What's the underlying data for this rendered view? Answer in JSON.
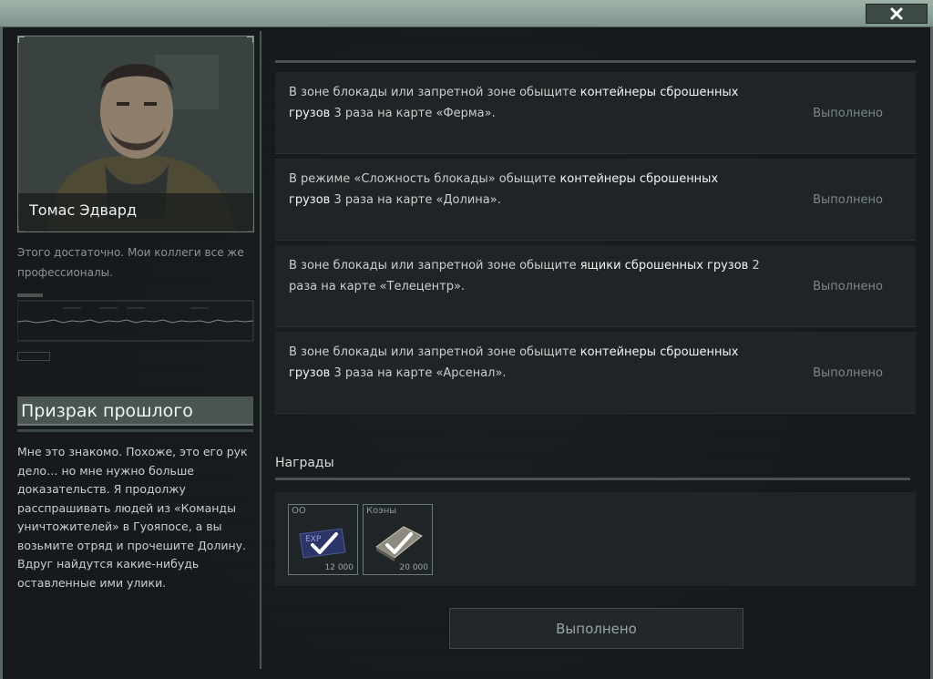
{
  "window": {
    "close_icon": "close-icon"
  },
  "npc": {
    "name": "Томас Эдвард",
    "speech": "Этого достаточно. Мои коллеги все же профессионалы."
  },
  "quest": {
    "title": "Призрак прошлого",
    "description": "Мне это знакомо. Похоже, это его рук дело… но мне нужно больше доказательств. Я продолжу расспрашивать людей из «Команды уничтожителей» в Гуояпосе, а вы возьмите отряд и прочешите Долину. Вдруг найдутся какие-нибудь оставленные ими улики."
  },
  "tasks": [
    {
      "pre": "В зоне блокады или запретной зоне обыщите ",
      "highlight": "контейнеры сброшенных грузов",
      "post": " 3 раза на карте «Ферма».",
      "status": "Выполнено"
    },
    {
      "pre": "В режиме «Сложность блокады» обыщите ",
      "highlight": "контейнеры сброшенных грузов",
      "post": " 3 раза на карте «Долина».",
      "status": "Выполнено"
    },
    {
      "pre": "В зоне блокады или запретной зоне обыщите ",
      "highlight": "ящики сброшенных грузов",
      "post": " 2 раза на карте «Телецентр».",
      "status": "Выполнено"
    },
    {
      "pre": "В зоне блокады или запретной зоне обыщите ",
      "highlight": "контейнеры сброшенных грузов",
      "post": " 3 раза на карте «Арсенал».",
      "status": "Выполнено"
    }
  ],
  "rewards": {
    "title": "Награды",
    "items": [
      {
        "label": "ОО",
        "amount": "12 000",
        "icon": "exp-icon"
      },
      {
        "label": "Коэны",
        "amount": "20 000",
        "icon": "coins-icon"
      }
    ]
  },
  "complete_button": "Выполнено"
}
